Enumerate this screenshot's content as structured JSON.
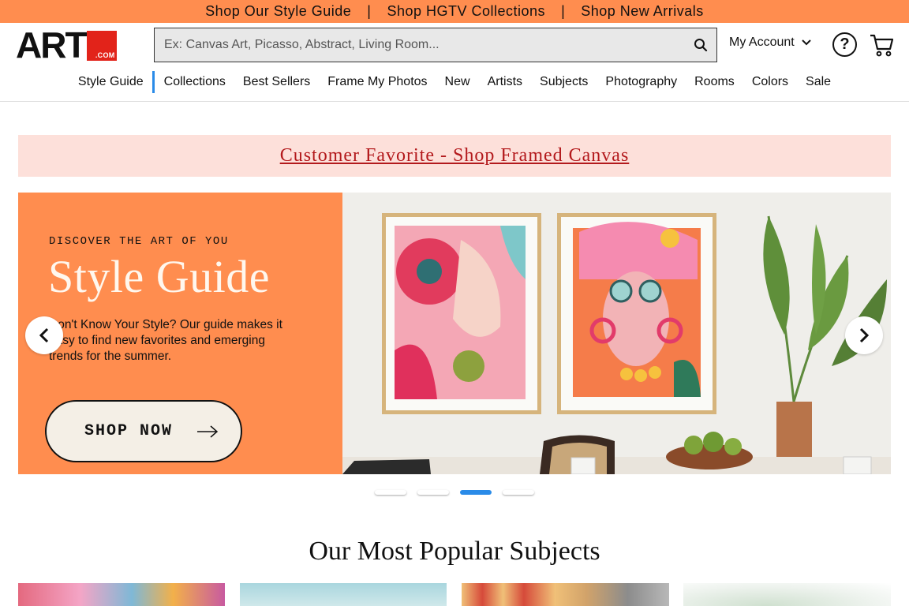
{
  "promo_bar": {
    "links": [
      "Shop Our Style Guide",
      "Shop HGTV Collections",
      "Shop New Arrivals"
    ],
    "separator": "|"
  },
  "header": {
    "logo_text": "ART",
    "logo_suffix": ".COM",
    "search_placeholder": "Ex: Canvas Art, Picasso, Abstract, Living Room...",
    "account_label": "My Account",
    "icons": [
      "search-icon",
      "chevron-down-icon",
      "help-icon",
      "cart-icon"
    ]
  },
  "nav": {
    "items": [
      "Style Guide",
      "Collections",
      "Best Sellers",
      "Frame My Photos",
      "New",
      "Artists",
      "Subjects",
      "Photography",
      "Rooms",
      "Colors",
      "Sale"
    ]
  },
  "banner": {
    "text": "Customer Favorite - Shop Framed Canvas"
  },
  "hero": {
    "eyebrow": "DISCOVER THE ART OF YOU",
    "title": "Style Guide",
    "description": "Don't Know Your Style? Our guide makes it easy to find new favorites and emerging trends for the summer.",
    "cta_label": "SHOP NOW",
    "slide_count": 4,
    "active_slide": 3
  },
  "popular": {
    "title": "Our Most Popular Subjects"
  },
  "colors": {
    "promo": "#ff8d4f",
    "accent_blue": "#2a8be8",
    "banner_bg": "#fde0da",
    "banner_text": "#b3191c",
    "logo_red": "#e2231a"
  }
}
